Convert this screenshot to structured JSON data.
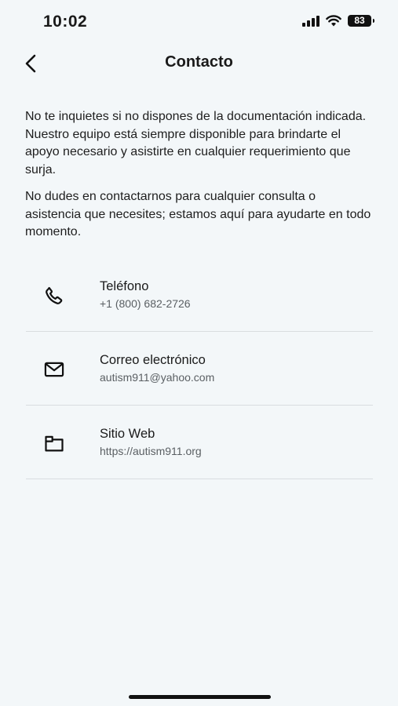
{
  "status_bar": {
    "time": "10:02",
    "battery": "83"
  },
  "header": {
    "title": "Contacto"
  },
  "intro": {
    "paragraph1": "No te inquietes si no dispones de la documentación indicada. Nuestro equipo está siempre disponible para brindarte el apoyo necesario y asistirte en cualquier requerimiento que surja.",
    "paragraph2": "No dudes en contactarnos para cualquier consulta o asistencia que necesites; estamos aquí para ayudarte en todo momento."
  },
  "contacts": [
    {
      "icon": "phone-icon",
      "label": "Teléfono",
      "value": "+1 (800) 682-2726"
    },
    {
      "icon": "mail-icon",
      "label": "Correo electrónico",
      "value": "autism911@yahoo.com"
    },
    {
      "icon": "website-icon",
      "label": "Sitio Web",
      "value": "https://autism911.org"
    }
  ]
}
